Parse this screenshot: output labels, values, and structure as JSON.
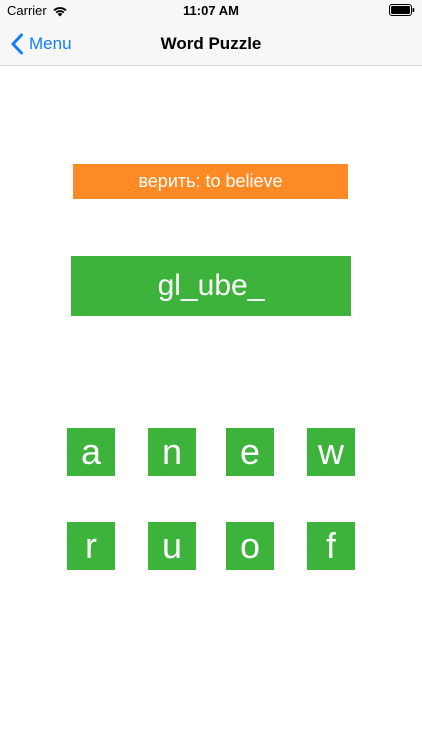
{
  "status_bar": {
    "carrier": "Carrier",
    "time": "11:07 AM"
  },
  "nav": {
    "back_label": "Menu",
    "title": "Word Puzzle",
    "accent_color": "#147efb"
  },
  "puzzle": {
    "hint": "верить: to believe",
    "word": "gl_ube_",
    "hint_color": "#fd8a24",
    "tile_color": "#3db33c"
  },
  "letters": {
    "row1": [
      "a",
      "n",
      "e",
      "w"
    ],
    "row2": [
      "r",
      "u",
      "o",
      "f"
    ]
  }
}
